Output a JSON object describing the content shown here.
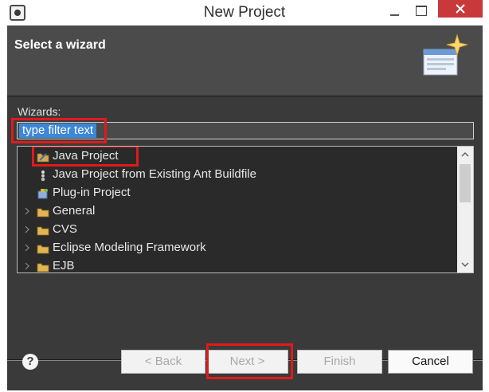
{
  "window": {
    "title": "New Project"
  },
  "header": {
    "title": "Select a wizard"
  },
  "wizards": {
    "label": "Wizards:",
    "filter_value": "type filter text",
    "items": [
      {
        "label": "Java Project",
        "icon": "java-project-icon",
        "selected": true
      },
      {
        "label": "Java Project from Existing Ant Buildfile",
        "icon": "ant-icon"
      },
      {
        "label": "Plug-in Project",
        "icon": "plugin-project-icon"
      },
      {
        "label": "General",
        "icon": "folder-icon",
        "expandable": true
      },
      {
        "label": "CVS",
        "icon": "folder-icon",
        "expandable": true
      },
      {
        "label": "Eclipse Modeling Framework",
        "icon": "folder-icon",
        "expandable": true
      },
      {
        "label": "EJB",
        "icon": "folder-icon",
        "expandable": true
      }
    ]
  },
  "buttons": {
    "back": "< Back",
    "next": "Next >",
    "finish": "Finish",
    "cancel": "Cancel"
  },
  "colors": {
    "highlight": "#e01a1a",
    "selection": "#3d87d6",
    "close_button": "#c7393a"
  }
}
